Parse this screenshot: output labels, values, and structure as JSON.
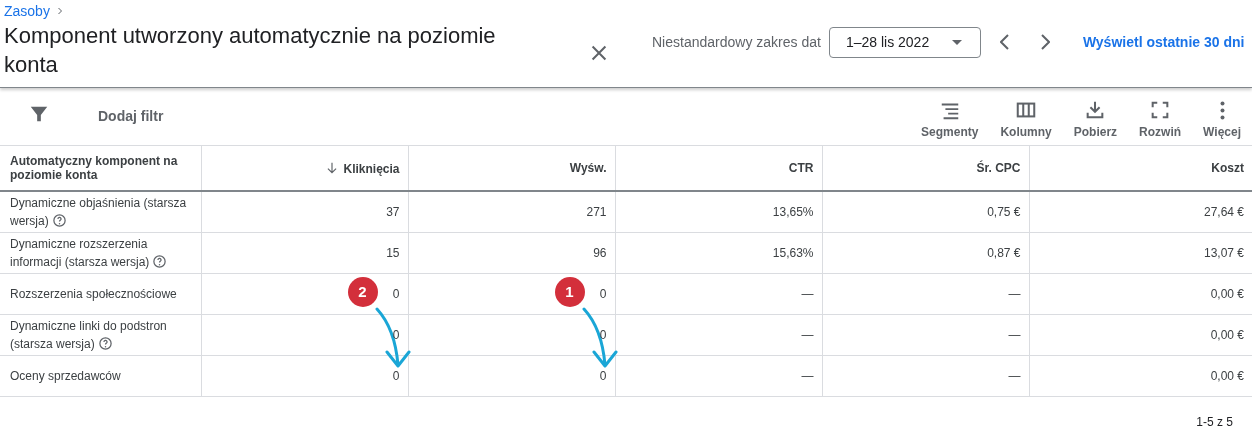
{
  "breadcrumb": "Zasoby",
  "title": "Komponent utworzony automatycznie na poziomie konta",
  "date_range": {
    "label": "Niestandardowy zakres dat",
    "value": "1–28 lis 2022"
  },
  "link": "Wyświetl ostatnie 30 dni",
  "filter": {
    "label": "Dodaj filtr"
  },
  "tools": [
    {
      "kind": "segments",
      "label": "Segmenty"
    },
    {
      "kind": "columns",
      "label": "Kolumny"
    },
    {
      "kind": "download",
      "label": "Pobierz"
    },
    {
      "kind": "expand",
      "label": "Rozwiń"
    },
    {
      "kind": "more",
      "label": "Więcej"
    }
  ],
  "table": {
    "columns": [
      {
        "label": "Automatyczny komponent na poziomie konta",
        "sorted": false
      },
      {
        "label": "Kliknięcia",
        "sorted": true
      },
      {
        "label": "Wyśw.",
        "sorted": false
      },
      {
        "label": "CTR",
        "sorted": false
      },
      {
        "label": "Śr. CPC",
        "sorted": false
      },
      {
        "label": "Koszt",
        "sorted": false
      }
    ],
    "rows": [
      {
        "cells": [
          {
            "value": "Dynamiczne objaśnienia (starsza wersja)",
            "help": true
          },
          "37",
          "271",
          "13,65%",
          "0,75 €",
          "27,64 €"
        ]
      },
      {
        "cells": [
          {
            "value": "Dynamiczne rozszerzenia informacji (starsza wersja)",
            "help": true
          },
          "15",
          "96",
          "15,63%",
          "0,87 €",
          "13,07 €"
        ]
      },
      {
        "cells": [
          {
            "value": "Rozszerzenia społecznościowe",
            "help": false
          },
          {
            "value": "0",
            "badge": "2"
          },
          {
            "value": "0",
            "badge": "1"
          },
          "—",
          "—",
          "0,00 €"
        ]
      },
      {
        "cells": [
          {
            "value": "Dynamiczne linki do podstron (starsza wersja)",
            "help": true
          },
          "0",
          "0",
          "—",
          "—",
          "0,00 €"
        ]
      },
      {
        "cells": [
          {
            "value": "Oceny sprzedawców",
            "help": false
          },
          "0",
          "0",
          "—",
          "—",
          "0,00 €"
        ]
      }
    ]
  },
  "pagination": "1-5 z 5"
}
